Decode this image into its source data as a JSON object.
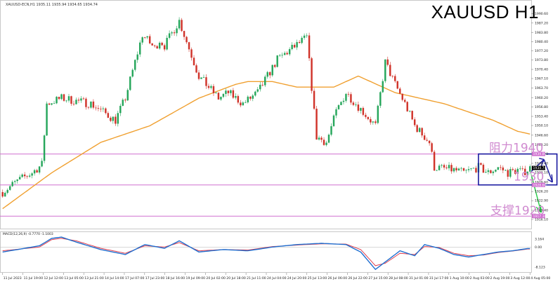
{
  "header": {
    "instrument_line": "XAUUSD-ECN,H1  1935.11 1935.94 1934.65 1934.74",
    "symbol": "XAUUSD H1",
    "macd_line": "MACD(12,26,9) -0.7770 -1.1003"
  },
  "annotations": {
    "resistance": "阻力1940",
    "range_mid": "1930",
    "support": "支撑1920"
  },
  "colors": {
    "bull_candle": "#26a65b",
    "bear_candle": "#d0332a",
    "moving_average": "#f0a030",
    "level_line": "#d070d0",
    "range_box": "#1a1aa0",
    "label_text": "#d08ad0",
    "macd_line": "#1f6fd0",
    "signal_line": "#e0404f"
  },
  "chart_data": {
    "type": "candlestick",
    "title": "XAUUSD H1",
    "y_axis_ticks": [
      "1990.60",
      "1987.20",
      "1983.80",
      "1980.40",
      "1977.20",
      "1973.80",
      "1970.40",
      "1967.10",
      "1963.70",
      "1960.20",
      "1956.80",
      "1953.40",
      "1950.10",
      "1946.60",
      "1943.20",
      "1939.80",
      "1936.40",
      "1933.10",
      "1929.60",
      "1926.20",
      "1922.90",
      "1919.40",
      "1916.10"
    ],
    "ylim": [
      1913.8,
      1993.5
    ],
    "x_axis_ticks": [
      "11 Jul 2023",
      "11 Jul 19:00",
      "12 Jul 12:00",
      "13 Jul 05:00",
      "13 Jul 21:00",
      "14 Jul 14:00",
      "17 Jul 07:00",
      "17 Jul 23:00",
      "18 Jul 16:00",
      "19 Jul 09:00",
      "20 Jul 02:00",
      "20 Jul 18:00",
      "21 Jul 11:00",
      "24 Jul 04:00",
      "24 Jul 20:00",
      "25 Jul 13:00",
      "26 Jul 06:00",
      "26 Jul 22:00",
      "27 Jul 15:00",
      "28 Jul 08:00",
      "31 Jul 01:00",
      "31 Jul 17:00",
      "1 Aug 10:00",
      "2 Aug 03:00",
      "2 Aug 19:00",
      "3 Aug 12:00",
      "4 Aug 05:00"
    ],
    "price_anchors": {
      "x": [
        0,
        6,
        12,
        16,
        18,
        24,
        36,
        46,
        50,
        57,
        62,
        64,
        66,
        72,
        80,
        88,
        92,
        98,
        104,
        108,
        112,
        118,
        124,
        128,
        132,
        136,
        140,
        144,
        152,
        156,
        160,
        164,
        168,
        172,
        174,
        176,
        184,
        188,
        194,
        198,
        202,
        206,
        210,
        212,
        215
      ],
      "close": [
        1926,
        1930,
        1933,
        1936,
        1958,
        1960,
        1958,
        1952,
        1960,
        1983,
        1978,
        1981,
        1979,
        1988,
        1968,
        1960,
        1962,
        1958,
        1962,
        1968,
        1974,
        1978,
        1982,
        1946,
        1944,
        1955,
        1962,
        1958,
        1950,
        1973,
        1965,
        1958,
        1950,
        1946,
        1944,
        1935,
        1934,
        1933,
        1935,
        1933,
        1935,
        1933,
        1934,
        1933,
        1934.7
      ]
    },
    "moving_average": {
      "name": "MA",
      "x": [
        0,
        20,
        40,
        60,
        80,
        95,
        100,
        110,
        120,
        135,
        145,
        160,
        170,
        180,
        190,
        200,
        210,
        215
      ],
      "values": [
        1920,
        1933,
        1944,
        1950,
        1960,
        1965,
        1966,
        1966,
        1964,
        1964,
        1968,
        1962,
        1960,
        1958,
        1955,
        1952,
        1948,
        1947
      ]
    },
    "levels": [
      {
        "label": "阻力1940",
        "price": 1939.8
      },
      {
        "label": "1930",
        "price": 1928.6
      },
      {
        "label": "支撑1920",
        "price": 1917.3
      }
    ],
    "current_price_tag": "1934.74",
    "level_tags": [
      "1939.80",
      "1928.60",
      "1917.30"
    ],
    "range_box": {
      "x_from": 194,
      "x_to": 226,
      "price_low": 1928.6,
      "price_high": 1939.8
    },
    "macd": {
      "ticks": [
        "3.164",
        "0.00",
        "-8.123"
      ],
      "ylim": [
        -9.5,
        4.6
      ],
      "line_x": [
        0,
        15,
        20,
        24,
        30,
        40,
        50,
        58,
        66,
        72,
        80,
        90,
        100,
        110,
        120,
        130,
        140,
        146,
        152,
        156,
        162,
        168,
        172,
        178,
        184,
        190,
        196,
        202,
        208,
        214
      ],
      "line": [
        -2,
        0.5,
        3.5,
        4,
        2,
        -1,
        -3,
        1,
        -0.5,
        2.5,
        -2,
        -1,
        -1.5,
        0,
        1,
        1.5,
        1,
        -2,
        -9,
        -6,
        -1.5,
        -3.5,
        1,
        -0.5,
        -3,
        -4,
        -3,
        -2,
        -1.5,
        -0.6
      ],
      "signal": [
        -1.5,
        0,
        3,
        3.5,
        2.5,
        -0.5,
        -2.5,
        0.5,
        0,
        1.8,
        -1.5,
        -1,
        -1.2,
        0.2,
        0.8,
        1.3,
        1.2,
        -1,
        -7.5,
        -6.5,
        -2.5,
        -3,
        0.2,
        -0.2,
        -2.5,
        -3.5,
        -3.2,
        -2.2,
        -1.6,
        -0.8
      ]
    }
  }
}
